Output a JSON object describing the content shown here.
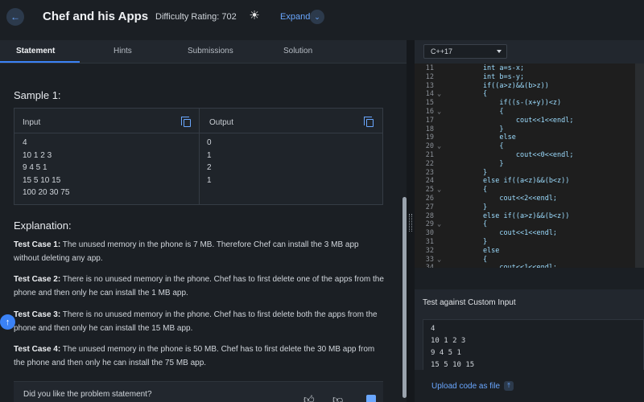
{
  "header": {
    "title": "Chef and his Apps",
    "difficulty": "Difficulty Rating: 702",
    "expand_label": "Expand",
    "theme_icon": "sun-icon",
    "back_icon": "arrow-left-icon"
  },
  "tabs": [
    "Statement",
    "Hints",
    "Submissions",
    "Solution"
  ],
  "statement": {
    "sample_title": "Sample 1:",
    "input_label": "Input",
    "output_label": "Output",
    "input_lines": [
      "4",
      "10 1 2 3",
      "9 4 5 1",
      "15 5 10 15",
      "100 20 30 75"
    ],
    "output_lines": [
      "0",
      "1",
      "2",
      "1"
    ],
    "explanation_title": "Explanation:",
    "cases": [
      {
        "label": "Test Case 1:",
        "text": "The unused memory in the phone is 7 MB. Therefore Chef can install the 3 MB app without deleting any app."
      },
      {
        "label": "Test Case 2:",
        "text": "There is no unused memory in the phone. Chef has to first delete one of the apps from the phone and then only he can install the 1 MB app."
      },
      {
        "label": "Test Case 3:",
        "text": "There is no unused memory in the phone. Chef has to first delete both the apps from the phone and then only he can install the 15 MB app."
      },
      {
        "label": "Test Case 4:",
        "text": "The unused memory in the phone is 50 MB. Chef has to first delete the 30 MB app from the phone and then only he can install the 75 MB app."
      }
    ],
    "feedback_question": "Did you like the problem statement?"
  },
  "editor": {
    "language": "C++17",
    "lines": [
      {
        "n": "11",
        "fold": "",
        "code": "        int a=s-x;"
      },
      {
        "n": "12",
        "fold": "",
        "code": "        int b=s-y;"
      },
      {
        "n": "13",
        "fold": "",
        "code": "        if((a>z)&&(b>z))"
      },
      {
        "n": "14",
        "fold": "⌄",
        "code": "        {"
      },
      {
        "n": "15",
        "fold": "",
        "code": "            if((s-(x+y))<z)"
      },
      {
        "n": "16",
        "fold": "⌄",
        "code": "            {"
      },
      {
        "n": "17",
        "fold": "",
        "code": "                cout<<1<<endl;"
      },
      {
        "n": "18",
        "fold": "",
        "code": "            }"
      },
      {
        "n": "19",
        "fold": "",
        "code": "            else"
      },
      {
        "n": "20",
        "fold": "⌄",
        "code": "            {"
      },
      {
        "n": "21",
        "fold": "",
        "code": "                cout<<0<<endl;"
      },
      {
        "n": "22",
        "fold": "",
        "code": "            }"
      },
      {
        "n": "23",
        "fold": "",
        "code": "        }"
      },
      {
        "n": "24",
        "fold": "",
        "code": "        else if((a<z)&&(b<z))"
      },
      {
        "n": "25",
        "fold": "⌄",
        "code": "        {"
      },
      {
        "n": "26",
        "fold": "",
        "code": "            cout<<2<<endl;"
      },
      {
        "n": "27",
        "fold": "",
        "code": "        }"
      },
      {
        "n": "28",
        "fold": "",
        "code": "        else if((a>z)&&(b<z))"
      },
      {
        "n": "29",
        "fold": "⌄",
        "code": "        {"
      },
      {
        "n": "30",
        "fold": "",
        "code": "            cout<<1<<endl;"
      },
      {
        "n": "31",
        "fold": "",
        "code": "        }"
      },
      {
        "n": "32",
        "fold": "",
        "code": "        else"
      },
      {
        "n": "33",
        "fold": "⌄",
        "code": "        {"
      },
      {
        "n": "34",
        "fold": "",
        "code": "            cout<<1<<endl;"
      }
    ]
  },
  "custom_input": {
    "title": "Test against Custom Input",
    "lines": [
      "4",
      "10 1 2 3",
      "9 4 5 1",
      "15 5 10 15"
    ],
    "upload_label": "Upload code as file"
  },
  "colors": {
    "accent": "#3b82f6",
    "link": "#6aa7ff",
    "background": "#1b1f24"
  }
}
